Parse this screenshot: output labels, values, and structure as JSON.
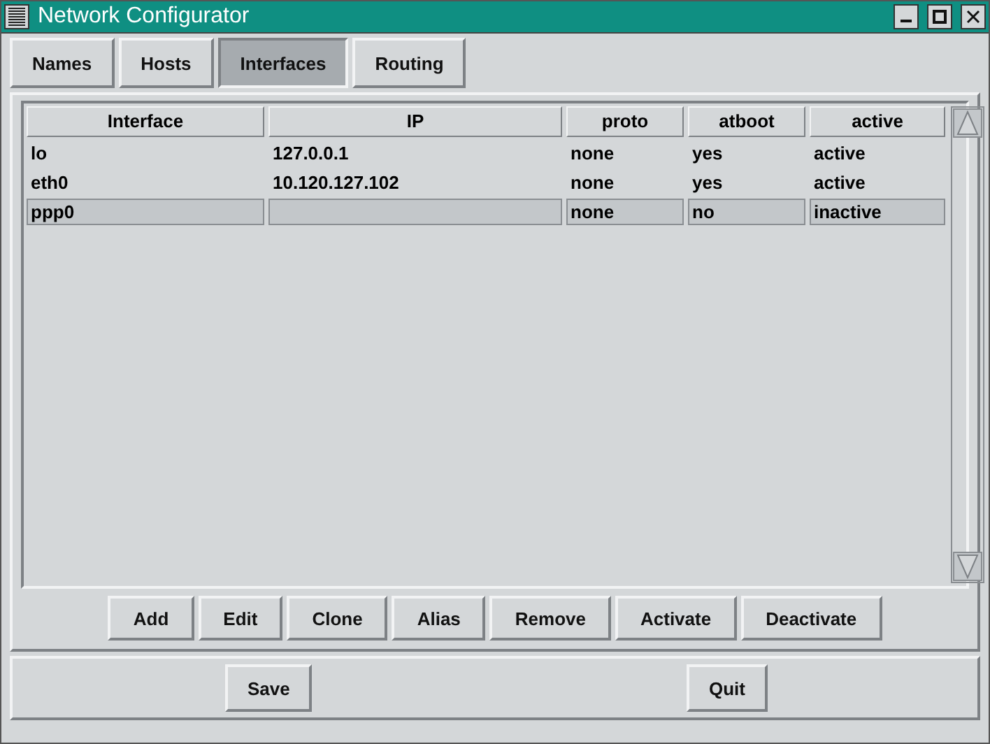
{
  "window": {
    "title": "Network Configurator"
  },
  "tabs": [
    {
      "label": "Names",
      "selected": false
    },
    {
      "label": "Hosts",
      "selected": false
    },
    {
      "label": "Interfaces",
      "selected": true
    },
    {
      "label": "Routing",
      "selected": false
    }
  ],
  "table": {
    "columns": [
      "Interface",
      "IP",
      "proto",
      "atboot",
      "active"
    ],
    "rows": [
      {
        "cells": [
          "lo",
          "127.0.0.1",
          "none",
          "yes",
          "active"
        ],
        "selected": false
      },
      {
        "cells": [
          "eth0",
          "10.120.127.102",
          "none",
          "yes",
          "active"
        ],
        "selected": false
      },
      {
        "cells": [
          "ppp0",
          "",
          "none",
          "no",
          "inactive"
        ],
        "selected": true
      }
    ]
  },
  "actions": [
    "Add",
    "Edit",
    "Clone",
    "Alias",
    "Remove",
    "Activate",
    "Deactivate"
  ],
  "footer_buttons": [
    "Save",
    "Quit"
  ]
}
